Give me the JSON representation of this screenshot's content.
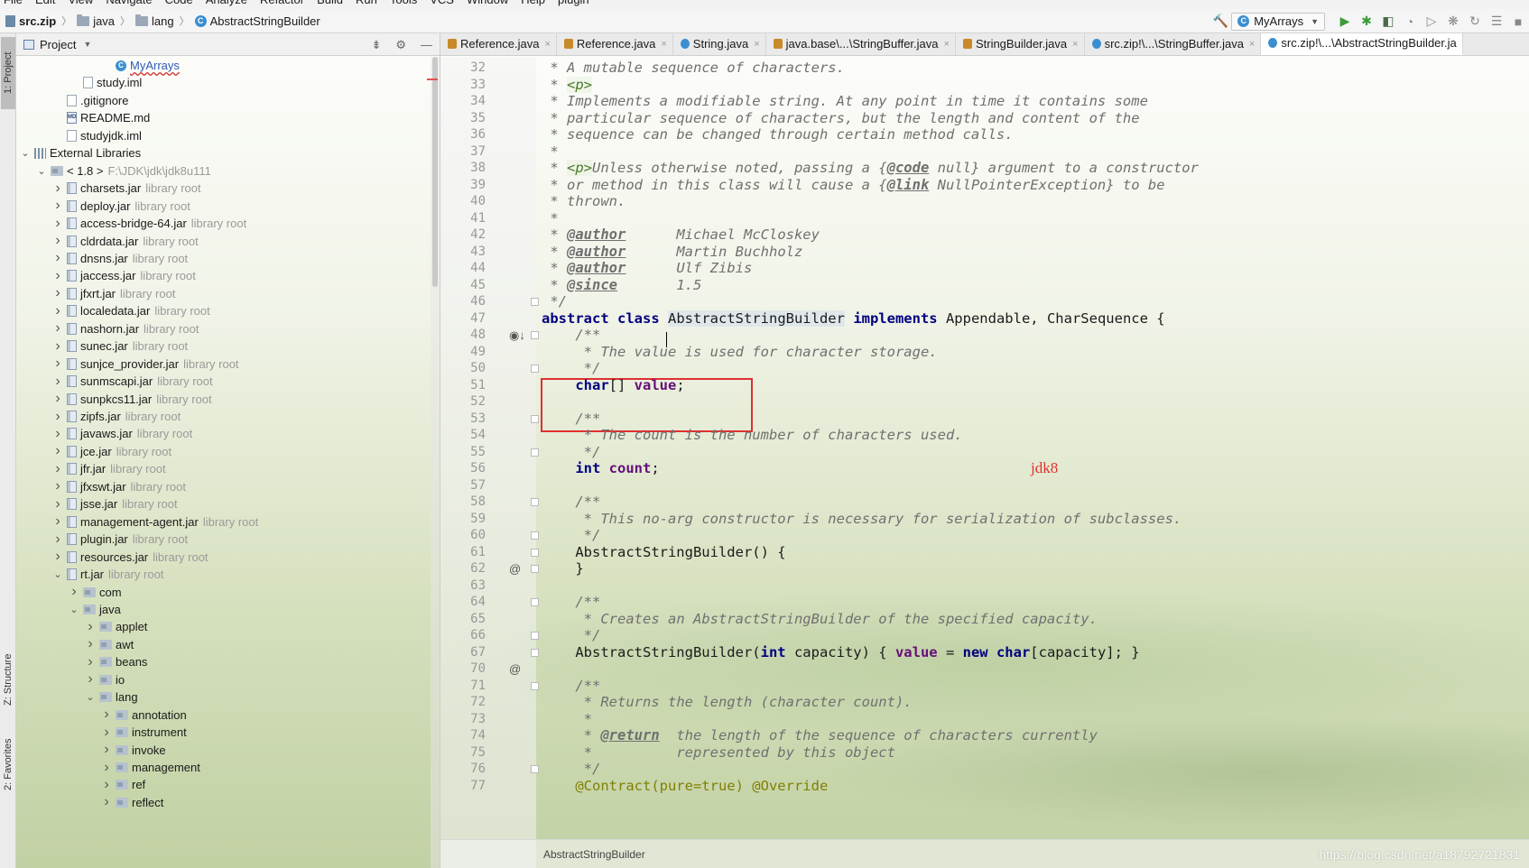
{
  "menu": [
    "File",
    "Edit",
    "View",
    "Navigate",
    "Code",
    "Analyze",
    "Refactor",
    "Build",
    "Run",
    "Tools",
    "VCS",
    "Window",
    "Help",
    "plugin"
  ],
  "breadcrumb": {
    "zip": "src.zip",
    "java": "java",
    "lang": "lang",
    "cls": "AbstractStringBuilder"
  },
  "toolbar": {
    "run_config": "MyArrays",
    "accent_green": "#3a9b3a"
  },
  "stripe": {
    "project": "1: Project",
    "structure": "Z: Structure",
    "favorites": "2: Favorites"
  },
  "project_panel": {
    "title": "Project",
    "rows": [
      {
        "label": "MyArrays",
        "hint": "",
        "icon": "class-icon",
        "indent": 5,
        "arrow": "",
        "special": "squiggle"
      },
      {
        "label": "study.iml",
        "hint": "",
        "icon": "file-icon",
        "indent": 3,
        "arrow": ""
      },
      {
        "label": ".gitignore",
        "hint": "",
        "icon": "file-icon",
        "indent": 2,
        "arrow": ""
      },
      {
        "label": "README.md",
        "hint": "",
        "icon": "md-icon",
        "indent": 2,
        "arrow": ""
      },
      {
        "label": "studyjdk.iml",
        "hint": "",
        "icon": "file-icon",
        "indent": 2,
        "arrow": ""
      },
      {
        "label": "External Libraries",
        "hint": "",
        "icon": "libs-icon",
        "indent": 0,
        "arrow": "v"
      },
      {
        "label": "< 1.8 >",
        "hint": "F:\\JDK\\jdk\\jdk8u111",
        "icon": "folder-icon",
        "indent": 1,
        "arrow": "v"
      },
      {
        "label": "charsets.jar",
        "hint": "library root",
        "icon": "jar-icon",
        "indent": 2,
        "arrow": ">"
      },
      {
        "label": "deploy.jar",
        "hint": "library root",
        "icon": "jar-icon",
        "indent": 2,
        "arrow": ">"
      },
      {
        "label": "access-bridge-64.jar",
        "hint": "library root",
        "icon": "jar-icon",
        "indent": 2,
        "arrow": ">"
      },
      {
        "label": "cldrdata.jar",
        "hint": "library root",
        "icon": "jar-icon",
        "indent": 2,
        "arrow": ">"
      },
      {
        "label": "dnsns.jar",
        "hint": "library root",
        "icon": "jar-icon",
        "indent": 2,
        "arrow": ">"
      },
      {
        "label": "jaccess.jar",
        "hint": "library root",
        "icon": "jar-icon",
        "indent": 2,
        "arrow": ">"
      },
      {
        "label": "jfxrt.jar",
        "hint": "library root",
        "icon": "jar-icon",
        "indent": 2,
        "arrow": ">"
      },
      {
        "label": "localedata.jar",
        "hint": "library root",
        "icon": "jar-icon",
        "indent": 2,
        "arrow": ">"
      },
      {
        "label": "nashorn.jar",
        "hint": "library root",
        "icon": "jar-icon",
        "indent": 2,
        "arrow": ">"
      },
      {
        "label": "sunec.jar",
        "hint": "library root",
        "icon": "jar-icon",
        "indent": 2,
        "arrow": ">"
      },
      {
        "label": "sunjce_provider.jar",
        "hint": "library root",
        "icon": "jar-icon",
        "indent": 2,
        "arrow": ">"
      },
      {
        "label": "sunmscapi.jar",
        "hint": "library root",
        "icon": "jar-icon",
        "indent": 2,
        "arrow": ">"
      },
      {
        "label": "sunpkcs11.jar",
        "hint": "library root",
        "icon": "jar-icon",
        "indent": 2,
        "arrow": ">"
      },
      {
        "label": "zipfs.jar",
        "hint": "library root",
        "icon": "jar-icon",
        "indent": 2,
        "arrow": ">"
      },
      {
        "label": "javaws.jar",
        "hint": "library root",
        "icon": "jar-icon",
        "indent": 2,
        "arrow": ">"
      },
      {
        "label": "jce.jar",
        "hint": "library root",
        "icon": "jar-icon",
        "indent": 2,
        "arrow": ">"
      },
      {
        "label": "jfr.jar",
        "hint": "library root",
        "icon": "jar-icon",
        "indent": 2,
        "arrow": ">"
      },
      {
        "label": "jfxswt.jar",
        "hint": "library root",
        "icon": "jar-icon",
        "indent": 2,
        "arrow": ">"
      },
      {
        "label": "jsse.jar",
        "hint": "library root",
        "icon": "jar-icon",
        "indent": 2,
        "arrow": ">"
      },
      {
        "label": "management-agent.jar",
        "hint": "library root",
        "icon": "jar-icon",
        "indent": 2,
        "arrow": ">"
      },
      {
        "label": "plugin.jar",
        "hint": "library root",
        "icon": "jar-icon",
        "indent": 2,
        "arrow": ">"
      },
      {
        "label": "resources.jar",
        "hint": "library root",
        "icon": "jar-icon",
        "indent": 2,
        "arrow": ">"
      },
      {
        "label": "rt.jar",
        "hint": "library root",
        "icon": "jar-icon",
        "indent": 2,
        "arrow": "v"
      },
      {
        "label": "com",
        "hint": "",
        "icon": "folder-icon",
        "indent": 3,
        "arrow": ">"
      },
      {
        "label": "java",
        "hint": "",
        "icon": "folder-icon",
        "indent": 3,
        "arrow": "v"
      },
      {
        "label": "applet",
        "hint": "",
        "icon": "folder-icon",
        "indent": 4,
        "arrow": ">"
      },
      {
        "label": "awt",
        "hint": "",
        "icon": "folder-icon",
        "indent": 4,
        "arrow": ">"
      },
      {
        "label": "beans",
        "hint": "",
        "icon": "folder-icon",
        "indent": 4,
        "arrow": ">"
      },
      {
        "label": "io",
        "hint": "",
        "icon": "folder-icon",
        "indent": 4,
        "arrow": ">"
      },
      {
        "label": "lang",
        "hint": "",
        "icon": "folder-icon",
        "indent": 4,
        "arrow": "v"
      },
      {
        "label": "annotation",
        "hint": "",
        "icon": "folder-icon",
        "indent": 5,
        "arrow": ">"
      },
      {
        "label": "instrument",
        "hint": "",
        "icon": "folder-icon",
        "indent": 5,
        "arrow": ">"
      },
      {
        "label": "invoke",
        "hint": "",
        "icon": "folder-icon",
        "indent": 5,
        "arrow": ">"
      },
      {
        "label": "management",
        "hint": "",
        "icon": "folder-icon",
        "indent": 5,
        "arrow": ">"
      },
      {
        "label": "ref",
        "hint": "",
        "icon": "folder-icon",
        "indent": 5,
        "arrow": ">"
      },
      {
        "label": "reflect",
        "hint": "",
        "icon": "folder-icon",
        "indent": 5,
        "arrow": ">"
      }
    ]
  },
  "tabs": [
    {
      "label": "Reference.java",
      "active": false
    },
    {
      "label": "Reference.java",
      "active": false
    },
    {
      "label": "String.java",
      "active": false
    },
    {
      "label": "java.base\\...\\StringBuffer.java",
      "active": false
    },
    {
      "label": "StringBuilder.java",
      "active": false
    },
    {
      "label": "src.zip!\\...\\StringBuffer.java",
      "active": false
    },
    {
      "label": "src.zip!\\...\\AbstractStringBuilder.ja",
      "active": true
    }
  ],
  "code": [
    {
      "n": "32",
      "html": " <span class=\"cm\">* A mutable sequence of characters.</span>"
    },
    {
      "n": "33",
      "html": " <span class=\"cm\">* <span class=\"tag\">&lt;p&gt;</span></span>"
    },
    {
      "n": "34",
      "html": " <span class=\"cm\">* Implements a modifiable string. At any point in time it contains some</span>"
    },
    {
      "n": "35",
      "html": " <span class=\"cm\">* particular sequence of characters, but the length and content of the</span>"
    },
    {
      "n": "36",
      "html": " <span class=\"cm\">* sequence can be changed through certain method calls.</span>"
    },
    {
      "n": "37",
      "html": " <span class=\"cm\">*</span>"
    },
    {
      "n": "38",
      "html": " <span class=\"cm\">* <span class=\"tag\">&lt;p&gt;</span>Unless otherwise noted, passing a {<span class=\"doc-tag\">@code</span> null} argument to a constructor</span>"
    },
    {
      "n": "39",
      "html": " <span class=\"cm\">* or method in this class will cause a {<span class=\"doc-tag\">@link</span> NullPointerException} to be</span>"
    },
    {
      "n": "40",
      "html": " <span class=\"cm\">* thrown.</span>"
    },
    {
      "n": "41",
      "html": " <span class=\"cm\">*</span>"
    },
    {
      "n": "42",
      "html": " <span class=\"cm\">* <span class=\"doc-tag\">@author</span>      Michael McCloskey</span>"
    },
    {
      "n": "43",
      "html": " <span class=\"cm\">* <span class=\"doc-tag\">@author</span>      Martin Buchholz</span>"
    },
    {
      "n": "44",
      "html": " <span class=\"cm\">* <span class=\"doc-tag\">@author</span>      Ulf Zibis</span>"
    },
    {
      "n": "45",
      "html": " <span class=\"cm\">* <span class=\"doc-tag\">@since</span>       1.5</span>"
    },
    {
      "n": "46",
      "html": " <span class=\"cm\">*/</span>"
    },
    {
      "n": "47",
      "html": "<span class=\"kw\">abstract class</span> <span class=\"hl\">AbstractStringBuilder</span> <span class=\"kw\">implements</span> Appendable, CharSequence {"
    },
    {
      "n": "48",
      "html": "    <span class=\"cm\">/**</span>"
    },
    {
      "n": "49",
      "html": "     <span class=\"cm\">* The value is used for character storage.</span>"
    },
    {
      "n": "50",
      "html": "     <span class=\"cm\">*/</span>"
    },
    {
      "n": "51",
      "html": "    <span class=\"kw\">char</span>[] <span class=\"fld\">value</span>;"
    },
    {
      "n": "52",
      "html": ""
    },
    {
      "n": "53",
      "html": "    <span class=\"cm\">/**</span>"
    },
    {
      "n": "54",
      "html": "     <span class=\"cm\">* The count is the number of characters used.</span>"
    },
    {
      "n": "55",
      "html": "     <span class=\"cm\">*/</span>"
    },
    {
      "n": "56",
      "html": "    <span class=\"kw\">int</span> <span class=\"fld\">count</span>;"
    },
    {
      "n": "57",
      "html": ""
    },
    {
      "n": "58",
      "html": "    <span class=\"cm\">/**</span>"
    },
    {
      "n": "59",
      "html": "     <span class=\"cm\">* This no-arg constructor is necessary for serialization of subclasses.</span>"
    },
    {
      "n": "60",
      "html": "     <span class=\"cm\">*/</span>"
    },
    {
      "n": "61",
      "html": "    AbstractStringBuilder() {"
    },
    {
      "n": "62",
      "html": "    }"
    },
    {
      "n": "63",
      "html": ""
    },
    {
      "n": "64",
      "html": "    <span class=\"cm\">/**</span>"
    },
    {
      "n": "65",
      "html": "     <span class=\"cm\">* Creates an AbstractStringBuilder of the specified capacity.</span>"
    },
    {
      "n": "66",
      "html": "     <span class=\"cm\">*/</span>"
    },
    {
      "n": "67",
      "html": "    AbstractStringBuilder(<span class=\"kw\">int</span> capacity) { <span class=\"fld\">value</span> = <span class=\"kw\">new char</span>[capacity]; }"
    },
    {
      "n": "70",
      "html": ""
    },
    {
      "n": "71",
      "html": "    <span class=\"cm\">/**</span>"
    },
    {
      "n": "72",
      "html": "     <span class=\"cm\">* Returns the length (character count).</span>"
    },
    {
      "n": "73",
      "html": "     <span class=\"cm\">*</span>"
    },
    {
      "n": "74",
      "html": "     <span class=\"cm\">* <span class=\"doc-tag\">@return</span>  the length of the sequence of characters currently</span>"
    },
    {
      "n": "75",
      "html": "     <span class=\"cm\">*          represented by this object</span>"
    },
    {
      "n": "76",
      "html": "     <span class=\"cm\">*/</span>"
    },
    {
      "n": "77",
      "html": "    <span class=\"ann\">@Contract(pure=true) @Override</span>"
    }
  ],
  "annotation_note": "jdk8",
  "status": {
    "breadcrumb": "AbstractStringBuilder"
  },
  "watermark": "https://blog.csdn.net/a18792721831"
}
